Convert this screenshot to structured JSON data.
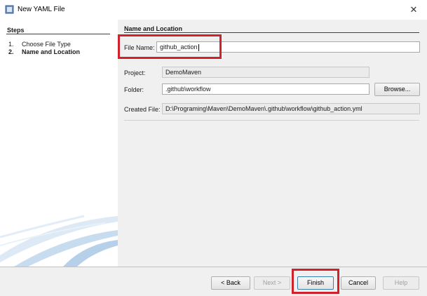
{
  "window": {
    "title": "New YAML File",
    "close_glyph": "✕"
  },
  "steps": {
    "title": "Steps",
    "items": [
      {
        "num": "1.",
        "label": "Choose File Type"
      },
      {
        "num": "2.",
        "label": "Name and Location"
      }
    ]
  },
  "main": {
    "section_title": "Name and Location",
    "file_name": {
      "label": "File Name:",
      "value": "github_action"
    },
    "project": {
      "label": "Project:",
      "value": "DemoMaven"
    },
    "folder": {
      "label": "Folder:",
      "value": ".github\\workflow"
    },
    "browse_label": "Browse...",
    "created_file": {
      "label": "Created File:",
      "value": "D:\\Programing\\Maven\\DemoMaven\\.github\\workflow\\github_action.yml"
    }
  },
  "buttons": {
    "back": "< Back",
    "next": "Next >",
    "finish": "Finish",
    "cancel": "Cancel",
    "help": "Help"
  },
  "colors": {
    "highlight": "#d0222a"
  },
  "icons": {
    "app": "yaml-file-icon",
    "close": "close-icon"
  }
}
